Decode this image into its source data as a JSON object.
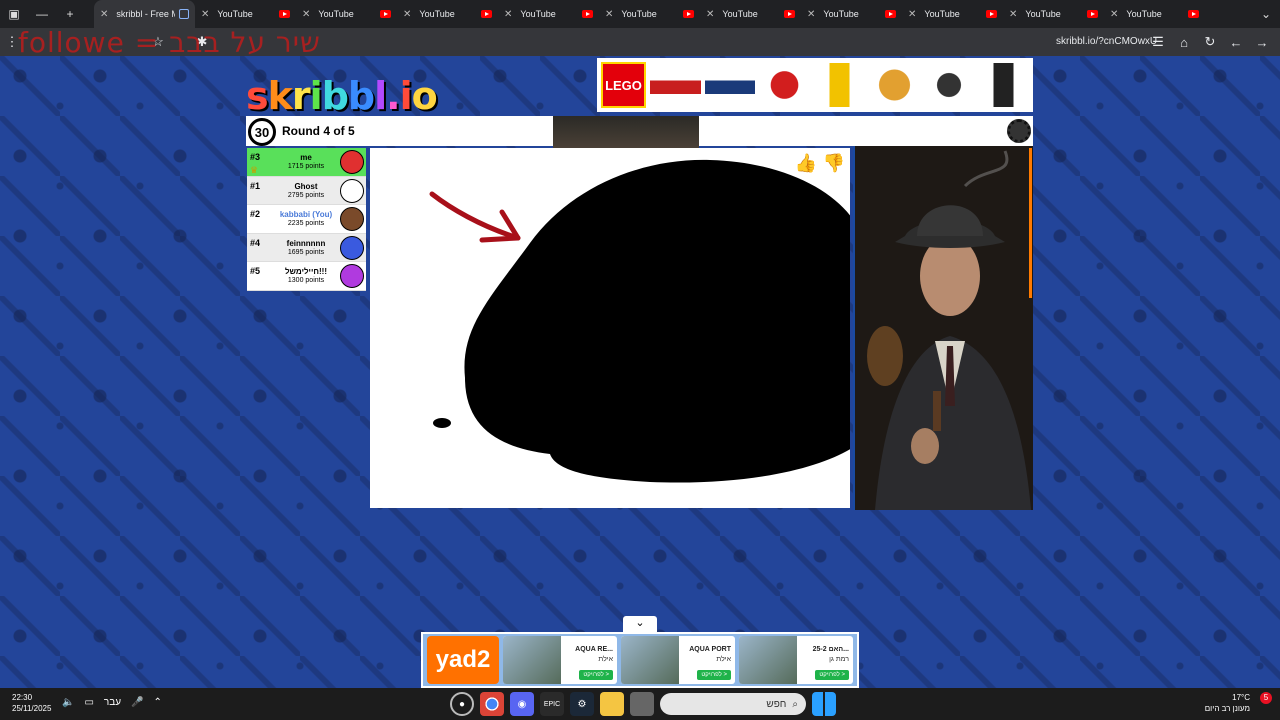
{
  "browser": {
    "tabs": [
      {
        "label": "skribbl - Free M",
        "active": true,
        "icon": "edit-icon"
      },
      {
        "label": "YouTube",
        "icon": "youtube-icon"
      },
      {
        "label": "YouTube",
        "icon": "youtube-icon"
      },
      {
        "label": "YouTube",
        "icon": "youtube-icon"
      },
      {
        "label": "YouTube",
        "icon": "youtube-icon"
      },
      {
        "label": "YouTube",
        "icon": "youtube-icon"
      },
      {
        "label": "YouTube",
        "icon": "youtube-icon"
      },
      {
        "label": "YouTube",
        "icon": "youtube-icon"
      },
      {
        "label": "YouTube",
        "icon": "youtube-icon"
      },
      {
        "label": "YouTube",
        "icon": "youtube-icon"
      },
      {
        "label": "YouTube",
        "icon": "youtube-icon"
      }
    ],
    "url": "skribbl.io/?cnCMOwxU",
    "overlay_text": "followe = שיר על בבב"
  },
  "game": {
    "logo": {
      "parts": [
        "s",
        "k",
        "r",
        "i",
        "b",
        "b",
        "l",
        ".",
        "i",
        "o"
      ],
      "colors": [
        "#ff4b3a",
        "#ff8c1a",
        "#ffe44a",
        "#5ee34a",
        "#40d9e0",
        "#3a8cff",
        "#b34aff",
        "#ff5ad0",
        "#ff4b3a",
        "#ffd540"
      ]
    },
    "timer": "30",
    "round": "Round 4 of 5",
    "ad_top_brand": "LEGO",
    "players": [
      {
        "rank": "#3",
        "name": "me",
        "points": "1715 points",
        "avatar_color": "#e03030",
        "highlight": "me",
        "crown": true
      },
      {
        "rank": "#1",
        "name": "Ghost",
        "points": "2795 points",
        "avatar_color": "#ffffff",
        "highlight": "alt"
      },
      {
        "rank": "#2",
        "name": "kabbabi (You)",
        "points": "2235 points",
        "avatar_color": "#7a4a2a",
        "highlight": "none",
        "is_you": true
      },
      {
        "rank": "#4",
        "name": "feinnnnnn",
        "points": "1695 points",
        "avatar_color": "#3a5adf",
        "highlight": "alt"
      },
      {
        "rank": "#5",
        "name": "חיילימשל!!!",
        "points": "1300 points",
        "avatar_color": "#b03adf",
        "highlight": "none"
      }
    ]
  },
  "bottom_ad": {
    "toggle_icon": "chevron-down-icon",
    "brand": "yad2",
    "cards": [
      {
        "title": "AQUA RE...",
        "sub": "אילת",
        "cta": "לפרויקט >"
      },
      {
        "title": "AQUA PORT",
        "sub": "אילת",
        "cta": "לפרויקט >"
      },
      {
        "title": "25-2 האם...",
        "sub": "רמת גן",
        "cta": "לפרויקט >"
      }
    ]
  },
  "taskbar": {
    "time": "22:30",
    "date": "25/11/2025",
    "lang": "עבר",
    "search_placeholder": "חפש",
    "weather_temp": "17°C",
    "weather_desc": "מעונן רב היום",
    "notification_count": "5"
  }
}
